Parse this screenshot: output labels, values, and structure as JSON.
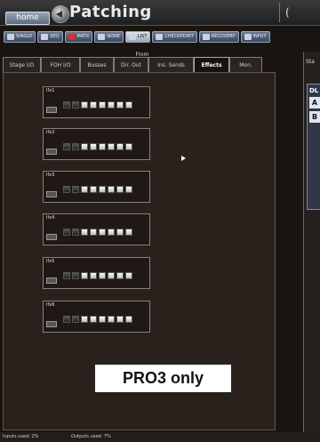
{
  "header": {
    "home_label": "home",
    "page_title": "Patching",
    "right_panel_label": "("
  },
  "toolbar": {
    "buttons": [
      {
        "label": "SINGLE"
      },
      {
        "label": "SEQ"
      },
      {
        "label": "MATX"
      },
      {
        "label": "NONE"
      },
      {
        "label": "LIST"
      },
      {
        "label": "CHECKPOINT"
      },
      {
        "label": "RECOVERY"
      },
      {
        "label": "INPUT"
      }
    ]
  },
  "from_label": "From",
  "tabs": [
    {
      "label": "Stage I/O",
      "active": false
    },
    {
      "label": "FOH I/O",
      "active": false
    },
    {
      "label": "Busses",
      "active": false
    },
    {
      "label": "Dir. Out",
      "active": false
    },
    {
      "label": "Ins. Sends",
      "active": false
    },
    {
      "label": "Effects",
      "active": true
    },
    {
      "label": "Mon.",
      "active": false
    }
  ],
  "effects": [
    {
      "label": "Ifx1"
    },
    {
      "label": "Ifx2"
    },
    {
      "label": "Ifx3"
    },
    {
      "label": "Ifx4"
    },
    {
      "label": "Ifx5"
    },
    {
      "label": "Ifx6"
    }
  ],
  "overlay_label": "PRO3 only",
  "right_panel": {
    "tab_label": "Sta",
    "box_label": "DL",
    "items": [
      "A",
      "B"
    ]
  },
  "status": {
    "inputs": "Inputs used: 2%",
    "outputs": "Outputs used: 7%"
  }
}
